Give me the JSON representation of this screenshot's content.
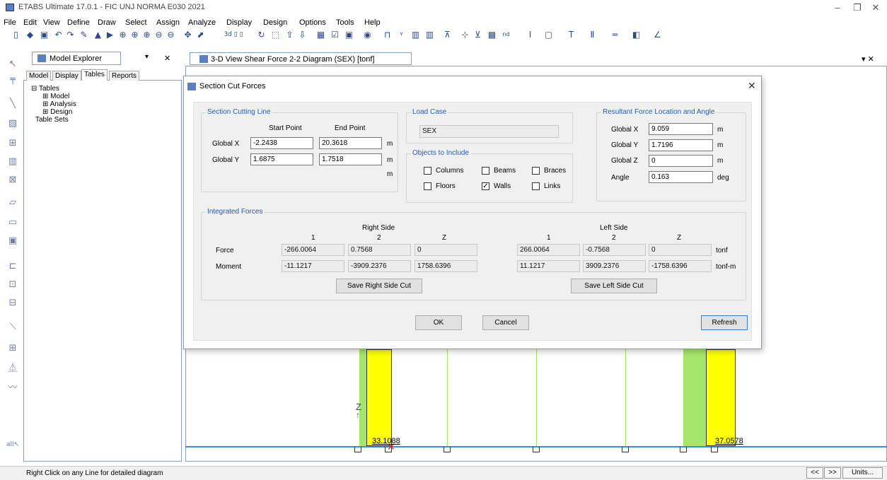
{
  "window": {
    "title": "ETABS Ultimate 17.0.1 - FIC UNJ NORMA E030 2021"
  },
  "menu": [
    "File",
    "Edit",
    "View",
    "Define",
    "Draw",
    "Select",
    "Assign",
    "Analyze",
    "Display",
    "Design",
    "Options",
    "Tools",
    "Help"
  ],
  "explorer": {
    "title": "Model Explorer",
    "tabs": [
      "Model",
      "Display",
      "Tables",
      "Reports"
    ],
    "tree": [
      "Tables",
      "Model",
      "Analysis",
      "Design",
      "Table Sets"
    ]
  },
  "view": {
    "tab_title": "3-D View   Shear Force 2-2 Diagram  (SEX)  [tonf]",
    "axis_label": "Z",
    "value_left": "33.1088",
    "value_right": "37.0578"
  },
  "dialog": {
    "title": "Section Cut Forces",
    "cutting_line": {
      "title": "Section Cutting Line",
      "start_label": "Start Point",
      "end_label": "End Point",
      "gx_label": "Global X",
      "gy_label": "Global Y",
      "gx_start": "-2.2438",
      "gx_end": "20.3618",
      "gy_start": "1.6875",
      "gy_end": "1.7518",
      "unit_m": "m"
    },
    "load_case": {
      "title": "Load Case",
      "value": "SEX"
    },
    "objects": {
      "title": "Objects to Include",
      "columns": "Columns",
      "beams": "Beams",
      "braces": "Braces",
      "floors": "Floors",
      "walls": "Walls",
      "links": "Links",
      "walls_checked": "✓"
    },
    "resultant": {
      "title": "Resultant Force Location and Angle",
      "gx_label": "Global X",
      "gy_label": "Global Y",
      "gz_label": "Global Z",
      "angle_label": "Angle",
      "gx": "9.059",
      "gy": "1.7196",
      "gz": "0",
      "angle": "0.163",
      "unit_m": "m",
      "unit_deg": "deg"
    },
    "integrated": {
      "title": "Integrated Forces",
      "right_label": "Right Side",
      "left_label": "Left Side",
      "col1": "1",
      "col2": "2",
      "colz": "Z",
      "force_label": "Force",
      "moment_label": "Moment",
      "right_force": [
        "-266.0064",
        "0.7568",
        "0"
      ],
      "right_moment": [
        "-11.1217",
        "-3909.2376",
        "1758.6396"
      ],
      "left_force": [
        "266.0064",
        "-0.7568",
        "0"
      ],
      "left_moment": [
        "11.1217",
        "3909.2376",
        "-1758.6396"
      ],
      "force_unit": "tonf",
      "moment_unit": "tonf-m",
      "save_right": "Save Right Side Cut",
      "save_left": "Save Left Side Cut"
    },
    "ok": "OK",
    "cancel": "Cancel",
    "refresh": "Refresh"
  },
  "status": {
    "text": "Right Click on any Line for detailed diagram",
    "btn_prev": "<<",
    "btn_next": ">>",
    "btn_units": "Units..."
  }
}
